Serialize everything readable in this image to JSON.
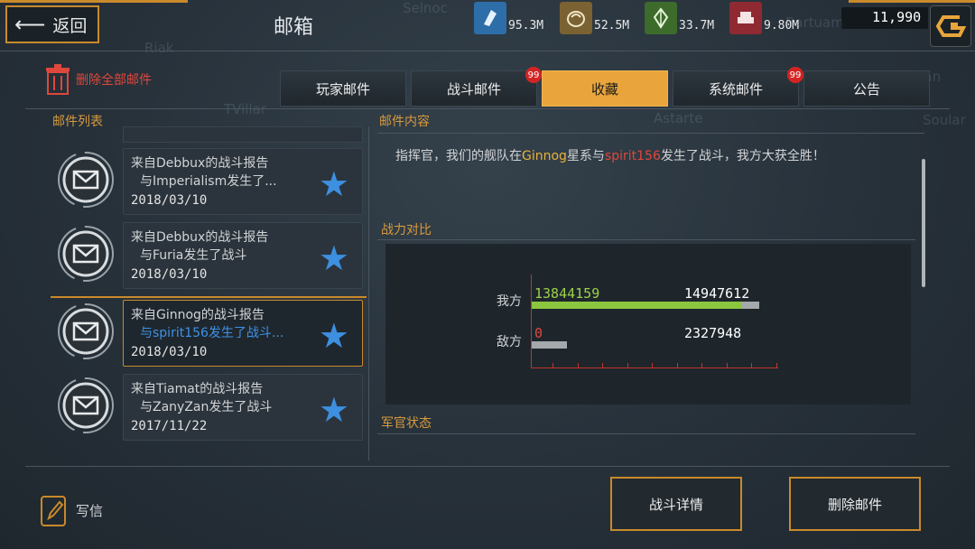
{
  "header": {
    "back_label": "返回",
    "title": "邮箱",
    "resources": [
      {
        "icon": "crystal-icon",
        "color": "#2d6ea8",
        "value": "95.3M"
      },
      {
        "icon": "ore-icon",
        "color": "#7a6232",
        "value": "52.5M"
      },
      {
        "icon": "gem-icon",
        "color": "#3c6b2c",
        "value": "33.7M"
      },
      {
        "icon": "alloy-icon",
        "color": "#8f2a33",
        "value": "9.80M"
      }
    ],
    "credits": "11,990"
  },
  "toolbar": {
    "delete_all_label": "删除全部邮件"
  },
  "tabs": [
    {
      "label": "玩家邮件",
      "badge": ""
    },
    {
      "label": "战斗邮件",
      "badge": "99"
    },
    {
      "label": "收藏",
      "badge": ""
    },
    {
      "label": "系统邮件",
      "badge": "99"
    },
    {
      "label": "公告",
      "badge": ""
    }
  ],
  "mail_list": {
    "title": "邮件列表",
    "items": [
      {
        "line1": "来自Debbux的战斗报告",
        "line2": "与Imperialism发生了...",
        "date": "2018/03/10"
      },
      {
        "line1": "来自Debbux的战斗报告",
        "line2": "与Furia发生了战斗",
        "date": "2018/03/10"
      },
      {
        "line1": "来自Ginnog的战斗报告",
        "line2": "与spirit156发生了战斗...",
        "date": "2018/03/10"
      },
      {
        "line1": "来自Tiamat的战斗报告",
        "line2": "与ZanyZan发生了战斗",
        "date": "2017/11/22"
      }
    ]
  },
  "mail_content": {
    "title": "邮件内容",
    "message": {
      "p1": "指挥官，我们的舰队在",
      "system": "Ginnog",
      "p2": "星系与",
      "enemy": "spirit156",
      "p3": "发生了战斗，我方大获全胜！"
    },
    "combat_compare": {
      "title": "战力对比",
      "own_label": "我方",
      "enemy_label": "敌方",
      "own_value": "13844159",
      "own_max": "14947612",
      "enemy_value": "0",
      "enemy_max": "2327948"
    },
    "officer_status_title": "军官状态"
  },
  "footer": {
    "write_label": "写信",
    "battle_detail_label": "战斗详情",
    "delete_mail_label": "删除邮件"
  },
  "colors": {
    "accent": "#c98a2b",
    "tab_active": "#e9a53c",
    "highlight_yellow": "#e8b23a",
    "highlight_red": "#e0473c",
    "star_blue": "#3d8fe0",
    "own_bar": "#8cc63f"
  }
}
